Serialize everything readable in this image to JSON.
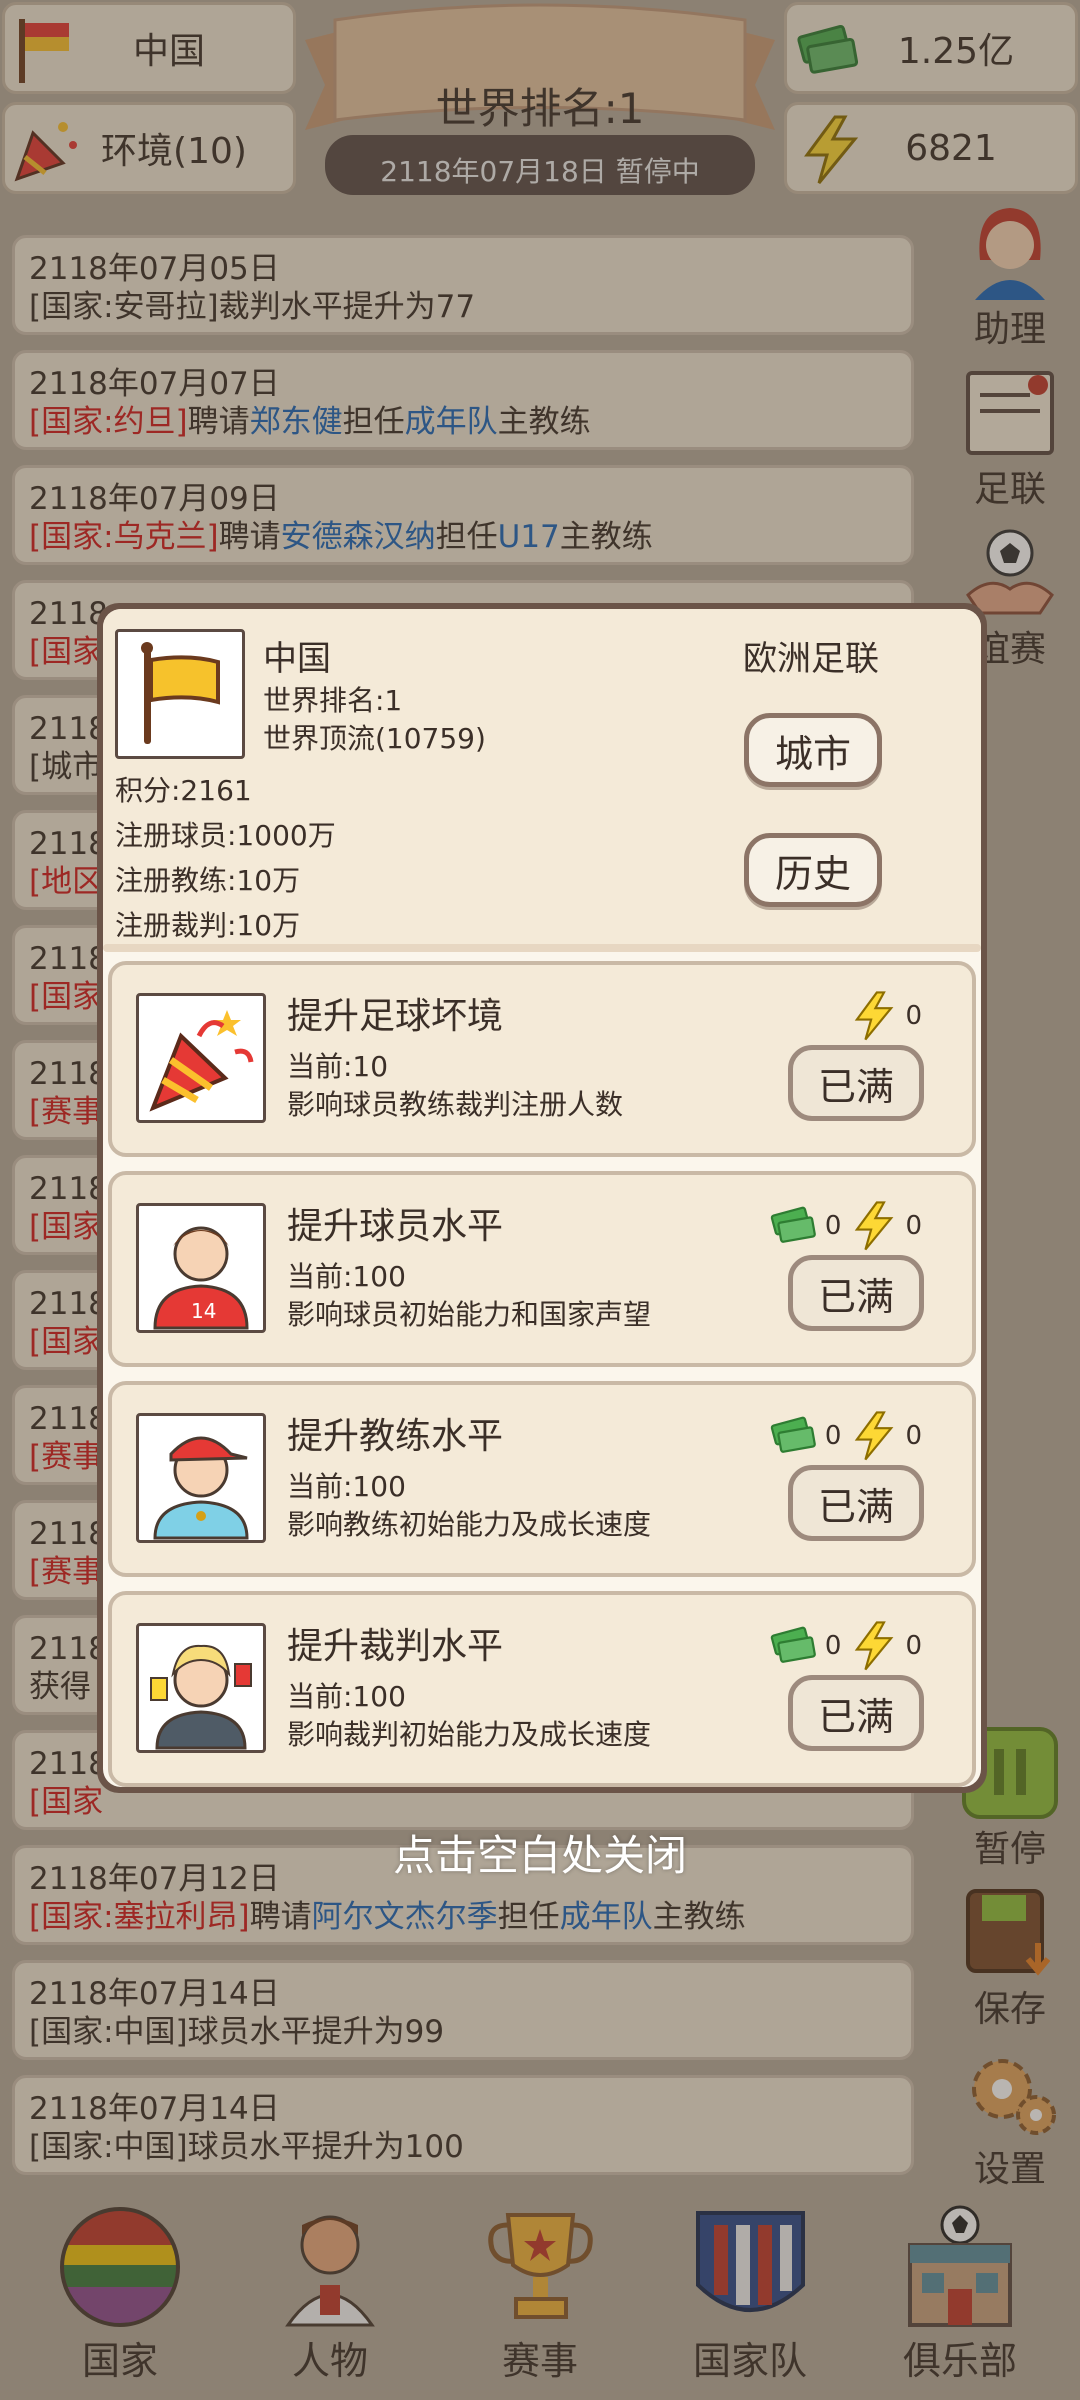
{
  "header": {
    "country": "中国",
    "environment": "环境(10)",
    "money": "1.25亿",
    "energy": "6821",
    "world_rank": "世界排名:1",
    "date_status": "2118年07月18日  暂停中"
  },
  "feed": [
    {
      "date": "2118年07月05日",
      "line": "[国家:安哥拉]裁判水平提升为77"
    },
    {
      "date": "2118年07月07日",
      "tag": "[国家:约旦]",
      "pre": "聘请",
      "name": "郑东健",
      "mid": "担任",
      "team": "成年队",
      "post": "主教练"
    },
    {
      "date": "2118年07月09日",
      "tag": "[国家:乌克兰]",
      "pre": "聘请",
      "name": "安德森汉纳",
      "mid": "担任",
      "team": "U17",
      "post": "主教练"
    },
    {
      "date": "2118年07月12日",
      "tag": "[国家:塞拉利昂]",
      "pre": "聘请",
      "name": "阿尔文杰尔季",
      "mid": "担任",
      "team": "成年队",
      "post": "主教练"
    },
    {
      "date": "2118年07月14日",
      "line": "[国家:中国]球员水平提升为99"
    },
    {
      "date": "2118年07月14日",
      "line": "[国家:中国]球员水平提升为100"
    }
  ],
  "feed_partial": [
    "2118",
    "[国家",
    "[城市",
    "[地区",
    "[赛事",
    "获得"
  ],
  "side": {
    "assistant": "助理",
    "confed": "足联",
    "friendly": "谊赛",
    "pause": "暂停",
    "save": "保存",
    "settings": "设置"
  },
  "nav": [
    "国家",
    "人物",
    "赛事",
    "国家队",
    "俱乐部"
  ],
  "modal": {
    "country": "中国",
    "rank": "世界排名:1",
    "tier": "世界顶流(10759)",
    "confed": "欧洲足联",
    "points": "积分:2161",
    "players": "注册球员:1000万",
    "coaches": "注册教练:10万",
    "referees": "注册裁判:10万",
    "city_btn": "城市",
    "history_btn": "历史",
    "upgrades": [
      {
        "title": "提升足球坏境",
        "current": "当前:10",
        "desc": "影响球员教练裁判注册人数",
        "money": null,
        "energy": "0",
        "button": "已满"
      },
      {
        "title": "提升球员水平",
        "current": "当前:100",
        "desc": "影响球员初始能力和国家声望",
        "money": "0",
        "energy": "0",
        "button": "已满"
      },
      {
        "title": "提升教练水平",
        "current": "当前:100",
        "desc": "影响教练初始能力及成长速度",
        "money": "0",
        "energy": "0",
        "button": "已满"
      },
      {
        "title": "提升裁判水平",
        "current": "当前:100",
        "desc": "影响裁判初始能力及成长速度",
        "money": "0",
        "energy": "0",
        "button": "已满"
      }
    ]
  },
  "close_hint": "点击空白处关闭",
  "colors": {
    "red": "#d21c1c",
    "blue": "#1e67b9",
    "panel": "#efe5d3",
    "modal_border": "#6b5448"
  }
}
